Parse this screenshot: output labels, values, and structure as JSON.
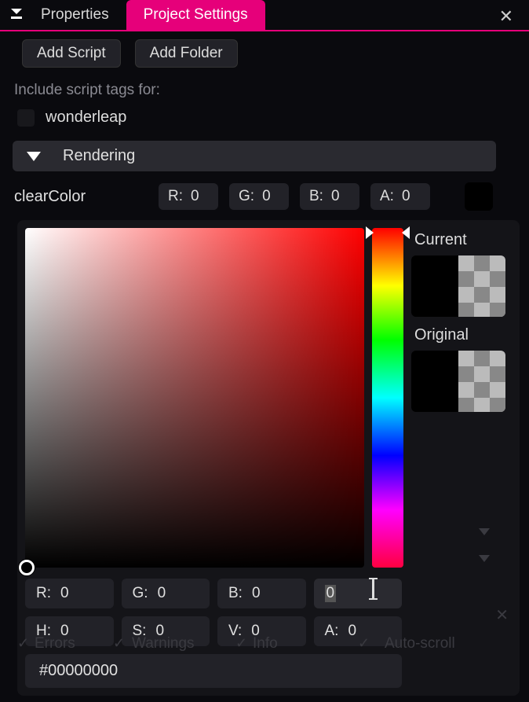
{
  "tabs": {
    "properties": "Properties",
    "project_settings": "Project Settings"
  },
  "buttons": {
    "add_script": "Add Script",
    "add_folder": "Add Folder"
  },
  "include_label": "Include script tags for:",
  "script_tags": {
    "wonderleap": "wonderleap"
  },
  "section_rendering": "Rendering",
  "clearColor": {
    "label": "clearColor",
    "r_label": "R:",
    "r": "0",
    "g_label": "G:",
    "g": "0",
    "b_label": "B:",
    "b": "0",
    "a_label": "A:",
    "a": "0"
  },
  "picker": {
    "current_label": "Current",
    "original_label": "Original",
    "r_label": "R:",
    "r": "0",
    "g_label": "G:",
    "g": "0",
    "b_label": "B:",
    "b": "0",
    "alpha_edit": "0",
    "h_label": "H:",
    "h": "0",
    "s_label": "S:",
    "s": "0",
    "v_label": "V:",
    "v": "0",
    "a_label": "A:",
    "a": "0",
    "hex": "#00000000"
  },
  "ghost": {
    "errors": "Errors",
    "warnings": "Warnings",
    "info": "Info",
    "autoscroll": "Auto-scroll"
  }
}
